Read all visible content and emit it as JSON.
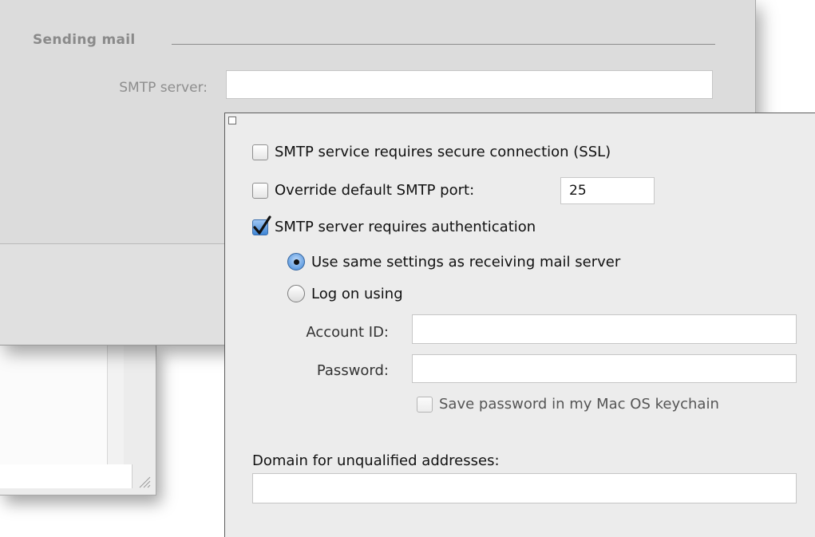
{
  "parent_window": {
    "section_title": "Sending mail",
    "smtp_server_label": "SMTP server:",
    "smtp_server_value": ""
  },
  "sheet": {
    "ssl_checkbox": {
      "label": "SMTP service requires secure connection (SSL)",
      "checked": false
    },
    "override_port_checkbox": {
      "label": "Override default SMTP port:",
      "checked": false
    },
    "port_value": "25",
    "auth_checkbox": {
      "label": "SMTP server requires authentication",
      "checked": true
    },
    "auth_options": [
      {
        "label": "Use same settings as receiving mail server",
        "selected": true
      },
      {
        "label": "Log on using",
        "selected": false
      }
    ],
    "account_id_label": "Account ID:",
    "account_id_value": "",
    "password_label": "Password:",
    "password_value": "",
    "keychain_checkbox": {
      "label": "Save password in my Mac OS keychain",
      "checked": false
    },
    "domain_label": "Domain for unqualified addresses:",
    "domain_value": ""
  },
  "colors": {
    "accent": "#3f86d6",
    "sheet_bg": "#ececec",
    "parent_bg": "#dcdcdc"
  }
}
